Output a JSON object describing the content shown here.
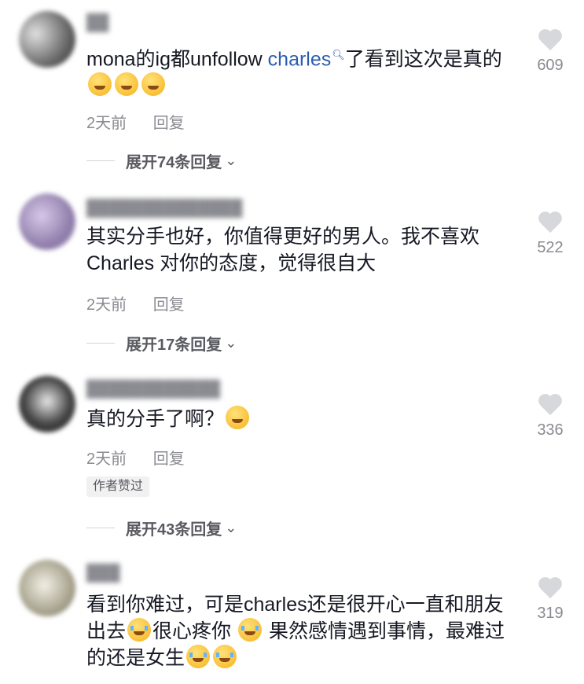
{
  "comments": [
    {
      "username": "██",
      "text_before": "mona的ig都unfollow ",
      "link": "charles",
      "text_after": "了看到这次是真的",
      "time": "2天前",
      "reply": "回复",
      "expand": "展开74条回复",
      "likes": "609"
    },
    {
      "username": "██████████████",
      "text": "其实分手也好，你值得更好的男人。我不喜欢Charles 对你的态度，觉得很自大",
      "time": "2天前",
      "reply": "回复",
      "expand": "展开17条回复",
      "likes": "522"
    },
    {
      "username": "████████████",
      "text": "真的分手了啊？",
      "time": "2天前",
      "reply": "回复",
      "badge": "作者赞过",
      "expand": "展开43条回复",
      "likes": "336"
    },
    {
      "username": "███",
      "text_1": "看到你难过，可是charles还是很开心一直和朋友出去",
      "text_2": "很心疼你",
      "text_3": "果然感情遇到事情，最难过的还是女生",
      "likes": "319"
    }
  ],
  "icons": {
    "like": "heart-icon",
    "expand": "chevron-down-icon",
    "search": "search-icon"
  }
}
